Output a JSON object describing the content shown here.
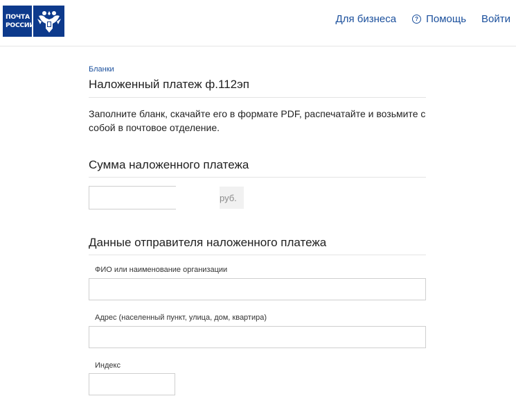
{
  "header": {
    "logo": {
      "line1": "ПОЧТА",
      "line2": "РОССИИ",
      "emblem_icon": "double-headed-eagle-icon",
      "brand_color": "#0d3a8c"
    },
    "nav": {
      "business": "Для бизнеса",
      "help": "Помощь",
      "help_icon": "question-circle-icon",
      "login": "Войти"
    }
  },
  "breadcrumb": "Бланки",
  "page_title": "Наложенный платеж ф.112эп",
  "intro": "Заполните бланк, скачайте его в формате PDF, распечатайте и возьмите с собой в почтовое отделение.",
  "sections": {
    "amount": {
      "title": "Сумма наложенного платежа",
      "unit": "руб.",
      "value": ""
    },
    "sender": {
      "title": "Данные отправителя наложенного платежа",
      "fields": [
        {
          "label": "ФИО или наименование организации",
          "value": ""
        },
        {
          "label": "Адрес (населенный пункт, улица, дом, квартира)",
          "value": ""
        },
        {
          "label": "Индекс",
          "value": ""
        }
      ]
    }
  },
  "colors": {
    "link": "#1a4f9c",
    "border": "#cfcfcf",
    "divider": "#e3e3e3"
  }
}
